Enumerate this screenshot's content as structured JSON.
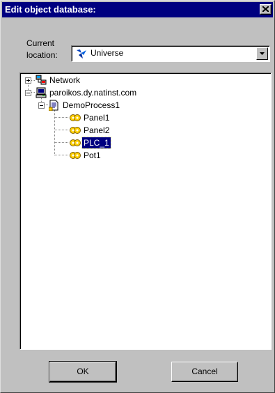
{
  "window": {
    "title": "Edit object database:",
    "close_icon": "close-icon"
  },
  "location": {
    "label_line1": "Current",
    "label_line2": "location:",
    "value": "Universe",
    "icon": "natinst-universe-icon"
  },
  "tree": {
    "nodes": [
      {
        "label": "Network",
        "icon": "network-icon",
        "expander": "+"
      },
      {
        "label": "paroikos.dy.natinst.com",
        "icon": "computer-icon",
        "expander": "-"
      },
      {
        "label": "DemoProcess1",
        "icon": "process-document-icon",
        "expander": "-"
      },
      {
        "label": "Panel1",
        "icon": "gear-object-icon"
      },
      {
        "label": "Panel2",
        "icon": "gear-object-icon"
      },
      {
        "label": "PLC_1",
        "icon": "gear-object-icon",
        "selected": true
      },
      {
        "label": "Pot1",
        "icon": "gear-object-icon"
      }
    ]
  },
  "buttons": {
    "ok": "OK",
    "cancel": "Cancel"
  },
  "colors": {
    "titlebar": "#000080",
    "selection": "#000080",
    "dialog_bg": "#c0c0c0"
  }
}
